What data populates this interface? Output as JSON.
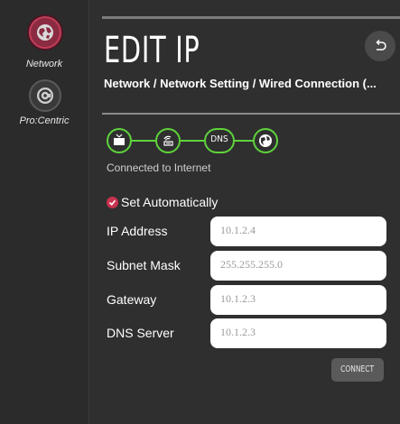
{
  "sidebar": {
    "items": [
      {
        "label": "Network",
        "icon": "network-globe-icon",
        "active": true
      },
      {
        "label": "Pro:Centric",
        "icon": "procentric-icon",
        "active": false
      }
    ]
  },
  "header": {
    "title": "EDIT IP",
    "breadcrumb": "Network / Network Setting / Wired Connection (...",
    "back_icon": "back-arrow-icon"
  },
  "status": {
    "nodes": [
      {
        "icon": "tv-icon"
      },
      {
        "icon": "router-icon"
      },
      {
        "icon": "dns-icon",
        "label": "DNS"
      },
      {
        "icon": "globe-icon"
      }
    ],
    "text": "Connected to Internet",
    "color": "#5ed33b"
  },
  "auto": {
    "label": "Set Automatically",
    "checked": true,
    "color": "#c8334f"
  },
  "form": {
    "ip": {
      "label": "IP Address",
      "value": "10.1.2.4"
    },
    "subnet": {
      "label": "Subnet Mask",
      "value": "255.255.255.0"
    },
    "gateway": {
      "label": "Gateway",
      "value": "10.1.2.3"
    },
    "dns": {
      "label": "DNS Server",
      "value": "10.1.2.3"
    }
  },
  "actions": {
    "connect_label": "CONNECT"
  },
  "colors": {
    "background": "#2f2f2f",
    "accent": "#c23e5a",
    "status_green": "#5ed33b"
  }
}
